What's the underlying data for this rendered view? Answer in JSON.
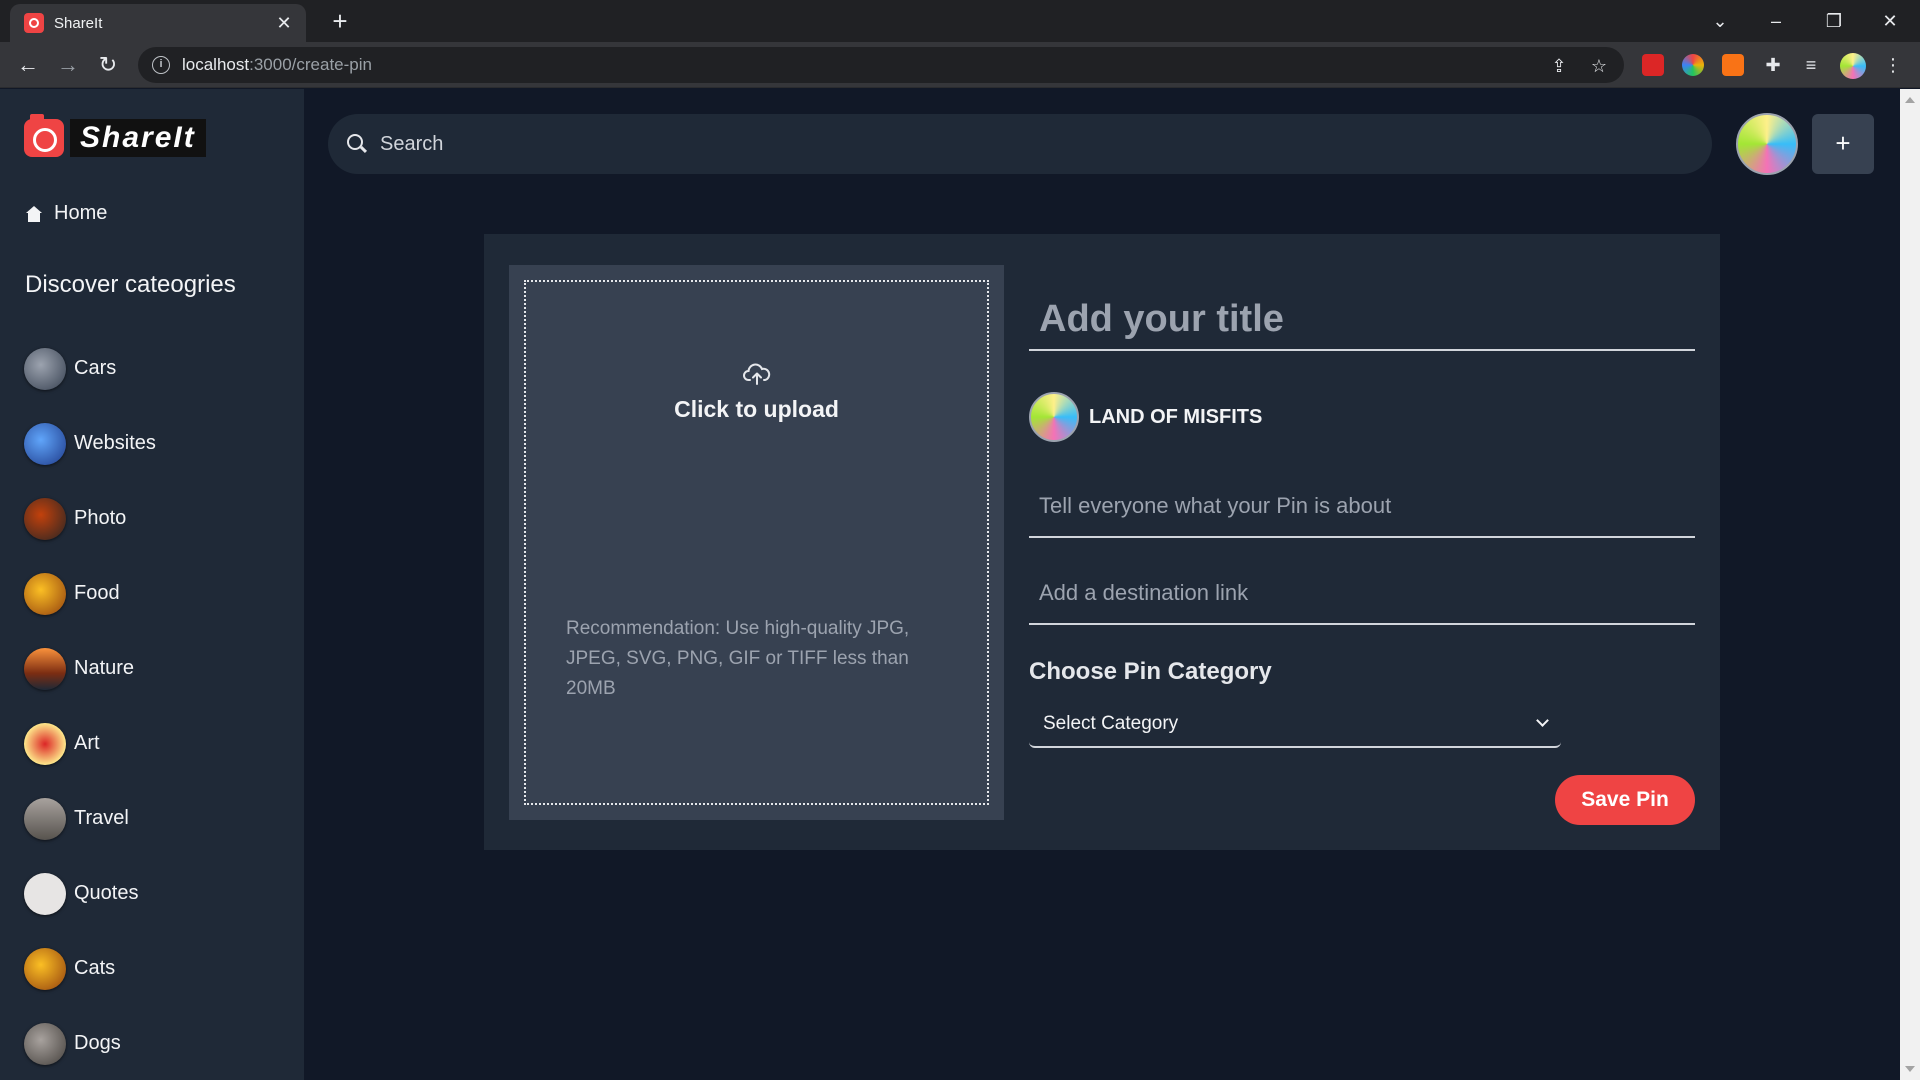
{
  "browser": {
    "tab_title": "ShareIt",
    "url_host": "localhost",
    "url_path": ":3000/create-pin"
  },
  "app": {
    "logo_text": "ShareIt",
    "home_label": "Home",
    "discover_heading": "Discover cateogries",
    "categories": [
      {
        "label": "Cars",
        "color": "#6b7280"
      },
      {
        "label": "Websites",
        "color": "#1e3a8a"
      },
      {
        "label": "Photo",
        "color": "#7c2d12"
      },
      {
        "label": "Food",
        "color": "#b45309"
      },
      {
        "label": "Nature",
        "color": "#c2410c"
      },
      {
        "label": "Art",
        "color": "#dc2626"
      },
      {
        "label": "Travel",
        "color": "#78716c"
      },
      {
        "label": "Quotes",
        "color": "#e7e5e4"
      },
      {
        "label": "Cats",
        "color": "#d97706"
      },
      {
        "label": "Dogs",
        "color": "#57534e"
      }
    ]
  },
  "header": {
    "search_placeholder": "Search",
    "add_button_icon": "+"
  },
  "create_pin": {
    "upload_label": "Click to upload",
    "upload_recommendation": "Recommendation: Use high-quality JPG, JPEG, SVG, PNG, GIF or TIFF less than 20MB",
    "title_placeholder": "Add your title",
    "owner_name": "LAND OF MISFITS",
    "about_placeholder": "Tell everyone what your Pin is about",
    "link_placeholder": "Add a destination link",
    "category_heading": "Choose Pin Category",
    "category_selected": "Select Category",
    "save_label": "Save Pin"
  },
  "colors": {
    "accent": "#ef4444",
    "sidebar_bg": "#1f2937",
    "page_bg": "#111827"
  }
}
